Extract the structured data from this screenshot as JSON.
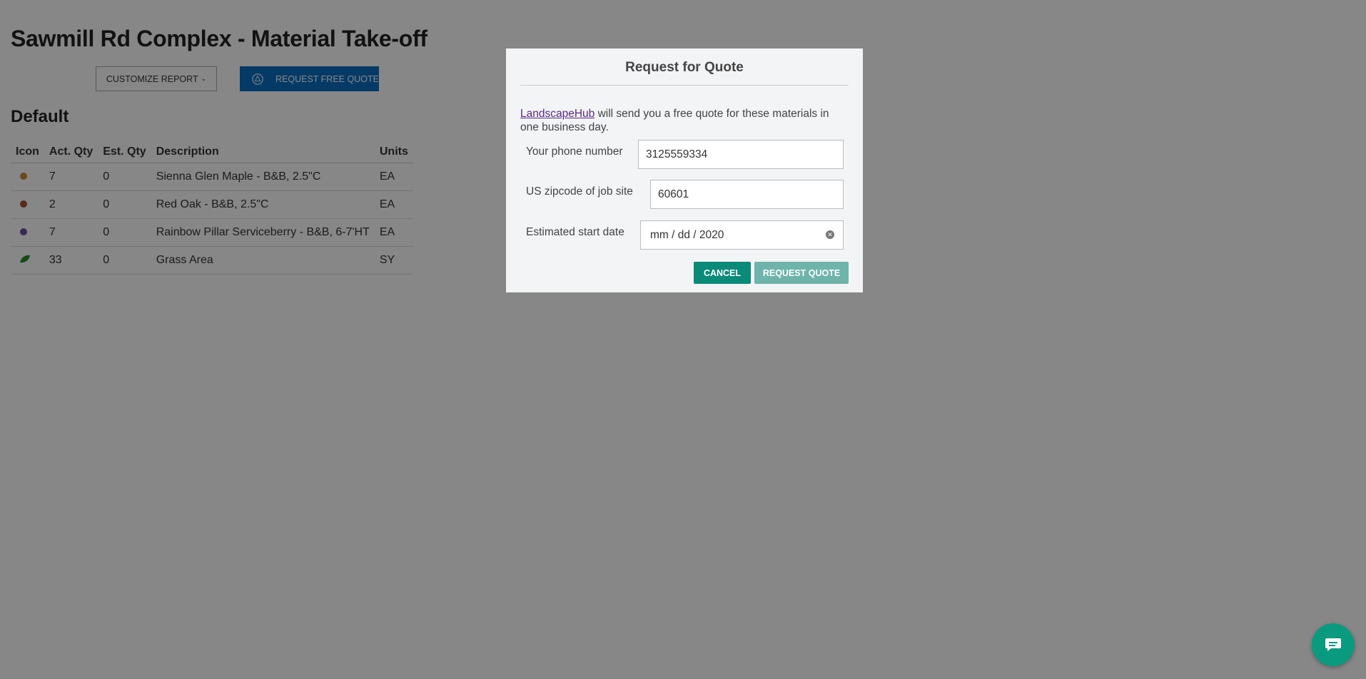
{
  "page": {
    "title": "Sawmill Rd Complex - Material Take-off",
    "customize_label": "CUSTOMIZE REPORT",
    "request_free_quote_label": "REQUEST FREE QUOTE",
    "section_title": "Default"
  },
  "table": {
    "headers": [
      "Icon",
      "Act. Qty",
      "Est. Qty",
      "Description",
      "Units"
    ],
    "rows": [
      {
        "icon": "orange-dot-icon",
        "color": "#d08a2e",
        "act": "7",
        "est": "0",
        "desc": "Sienna Glen Maple - B&B, 2.5\"C",
        "units": "EA"
      },
      {
        "icon": "brown-dot-icon",
        "color": "#a0522d",
        "act": "2",
        "est": "0",
        "desc": "Red Oak - B&B, 2.5\"C",
        "units": "EA"
      },
      {
        "icon": "purple-dot-icon",
        "color": "#6a4fa3",
        "act": "7",
        "est": "0",
        "desc": "Rainbow Pillar Serviceberry - B&B, 6-7'HT",
        "units": "EA"
      },
      {
        "icon": "grass-leaf-icon",
        "color": "#2e8b2e",
        "act": "33",
        "est": "0",
        "desc": "Grass Area",
        "units": "SY"
      }
    ]
  },
  "modal": {
    "title": "Request for Quote",
    "link_text": "LandscapeHub",
    "intro_rest": " will send you a free quote for these materials in one business day.",
    "phone_label": "Your phone number",
    "phone_value": "3125559334",
    "zip_label": "US zipcode of job site",
    "zip_value": "60601",
    "date_label": "Estimated start date",
    "date_value": "mm / dd / 2020",
    "cancel_label": "CANCEL",
    "request_label": "REQUEST QUOTE"
  },
  "colors": {
    "primary_blue": "#0a6fc2",
    "teal": "#0a8a78",
    "teal_disabled": "#6eb4ab",
    "chat": "#0a9a80"
  }
}
